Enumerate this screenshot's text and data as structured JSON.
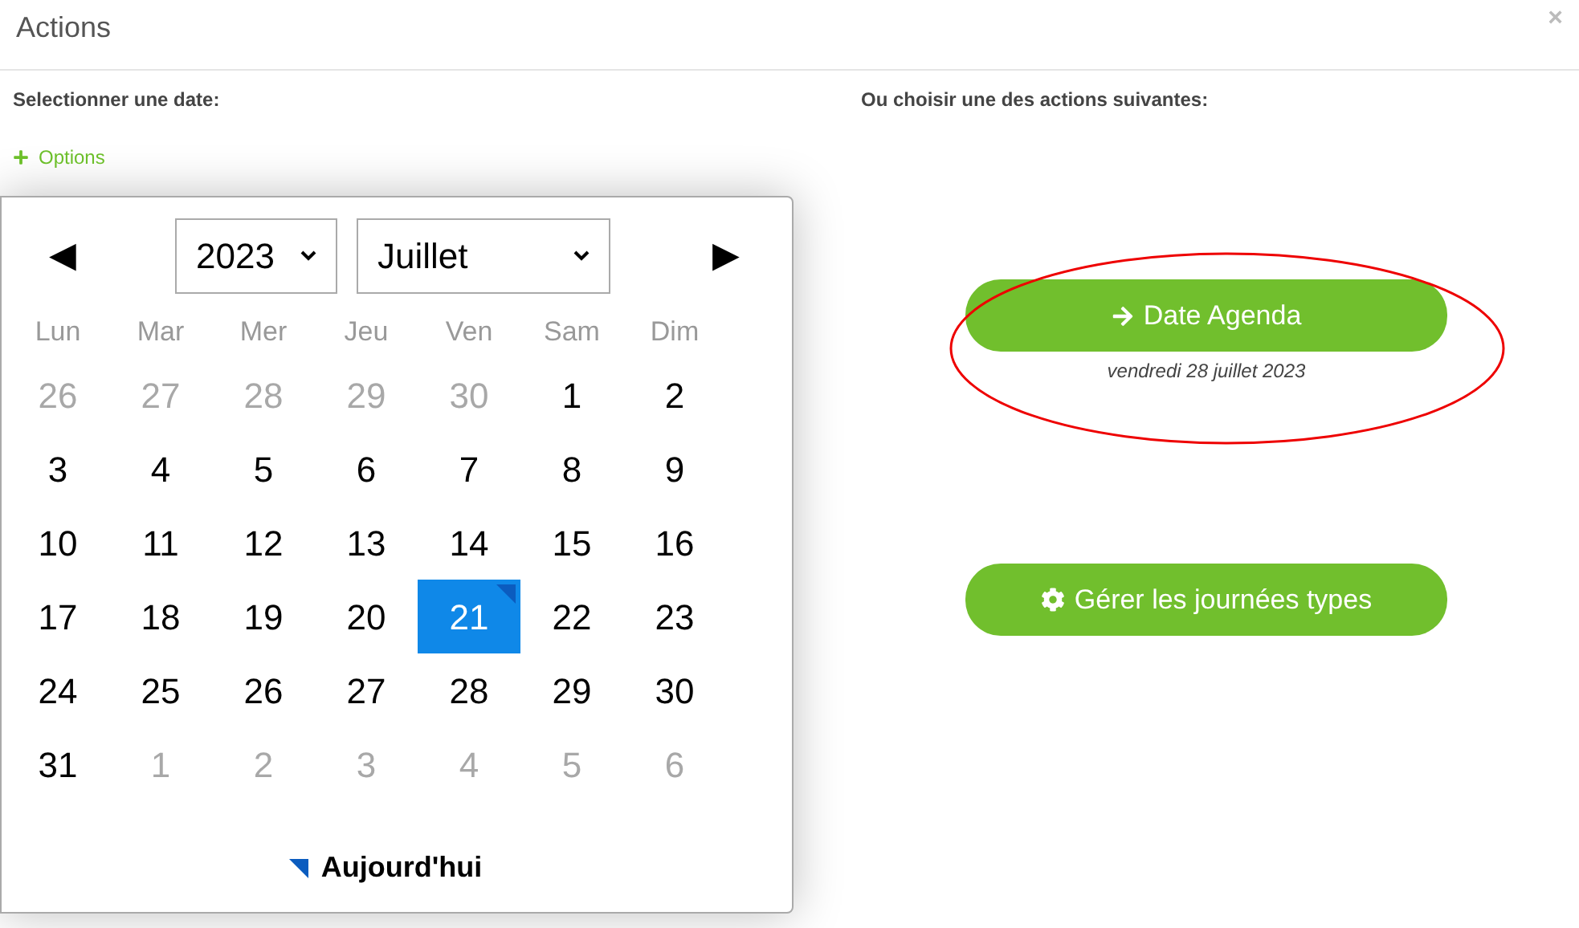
{
  "dialog": {
    "title": "Actions",
    "close": "×"
  },
  "left": {
    "label": "Selectionner une date:",
    "options_link": "Options"
  },
  "calendar": {
    "prev": "◀",
    "next": "▶",
    "year": "2023",
    "month": "Juillet",
    "weekdays": [
      "Lun",
      "Mar",
      "Mer",
      "Jeu",
      "Ven",
      "Sam",
      "Dim"
    ],
    "weeks": [
      [
        {
          "day": "26",
          "muted": true,
          "selected": false,
          "today": false
        },
        {
          "day": "27",
          "muted": true,
          "selected": false,
          "today": false
        },
        {
          "day": "28",
          "muted": true,
          "selected": false,
          "today": false
        },
        {
          "day": "29",
          "muted": true,
          "selected": false,
          "today": false
        },
        {
          "day": "30",
          "muted": true,
          "selected": false,
          "today": false
        },
        {
          "day": "1",
          "muted": false,
          "selected": false,
          "today": false
        },
        {
          "day": "2",
          "muted": false,
          "selected": false,
          "today": false
        }
      ],
      [
        {
          "day": "3",
          "muted": false,
          "selected": false,
          "today": false
        },
        {
          "day": "4",
          "muted": false,
          "selected": false,
          "today": false
        },
        {
          "day": "5",
          "muted": false,
          "selected": false,
          "today": false
        },
        {
          "day": "6",
          "muted": false,
          "selected": false,
          "today": false
        },
        {
          "day": "7",
          "muted": false,
          "selected": false,
          "today": false
        },
        {
          "day": "8",
          "muted": false,
          "selected": false,
          "today": false
        },
        {
          "day": "9",
          "muted": false,
          "selected": false,
          "today": false
        }
      ],
      [
        {
          "day": "10",
          "muted": false,
          "selected": false,
          "today": false
        },
        {
          "day": "11",
          "muted": false,
          "selected": false,
          "today": false
        },
        {
          "day": "12",
          "muted": false,
          "selected": false,
          "today": false
        },
        {
          "day": "13",
          "muted": false,
          "selected": false,
          "today": false
        },
        {
          "day": "14",
          "muted": false,
          "selected": false,
          "today": false
        },
        {
          "day": "15",
          "muted": false,
          "selected": false,
          "today": false
        },
        {
          "day": "16",
          "muted": false,
          "selected": false,
          "today": false
        }
      ],
      [
        {
          "day": "17",
          "muted": false,
          "selected": false,
          "today": false
        },
        {
          "day": "18",
          "muted": false,
          "selected": false,
          "today": false
        },
        {
          "day": "19",
          "muted": false,
          "selected": false,
          "today": false
        },
        {
          "day": "20",
          "muted": false,
          "selected": false,
          "today": false
        },
        {
          "day": "21",
          "muted": false,
          "selected": true,
          "today": true
        },
        {
          "day": "22",
          "muted": false,
          "selected": false,
          "today": false
        },
        {
          "day": "23",
          "muted": false,
          "selected": false,
          "today": false
        }
      ],
      [
        {
          "day": "24",
          "muted": false,
          "selected": false,
          "today": false
        },
        {
          "day": "25",
          "muted": false,
          "selected": false,
          "today": false
        },
        {
          "day": "26",
          "muted": false,
          "selected": false,
          "today": false
        },
        {
          "day": "27",
          "muted": false,
          "selected": false,
          "today": false
        },
        {
          "day": "28",
          "muted": false,
          "selected": false,
          "today": false
        },
        {
          "day": "29",
          "muted": false,
          "selected": false,
          "today": false
        },
        {
          "day": "30",
          "muted": false,
          "selected": false,
          "today": false
        }
      ],
      [
        {
          "day": "31",
          "muted": false,
          "selected": false,
          "today": false
        },
        {
          "day": "1",
          "muted": true,
          "selected": false,
          "today": false
        },
        {
          "day": "2",
          "muted": true,
          "selected": false,
          "today": false
        },
        {
          "day": "3",
          "muted": true,
          "selected": false,
          "today": false
        },
        {
          "day": "4",
          "muted": true,
          "selected": false,
          "today": false
        },
        {
          "day": "5",
          "muted": true,
          "selected": false,
          "today": false
        },
        {
          "day": "6",
          "muted": true,
          "selected": false,
          "today": false
        }
      ]
    ],
    "today_legend": "Aujourd'hui"
  },
  "right": {
    "label": "Ou choisir une des actions suivantes:",
    "actions": [
      {
        "kind": "arrow",
        "label": "Date Agenda",
        "note": "vendredi 28 juillet 2023",
        "circled": true
      },
      {
        "kind": "gear",
        "label": "Gérer les journées types",
        "circled": false
      }
    ]
  }
}
